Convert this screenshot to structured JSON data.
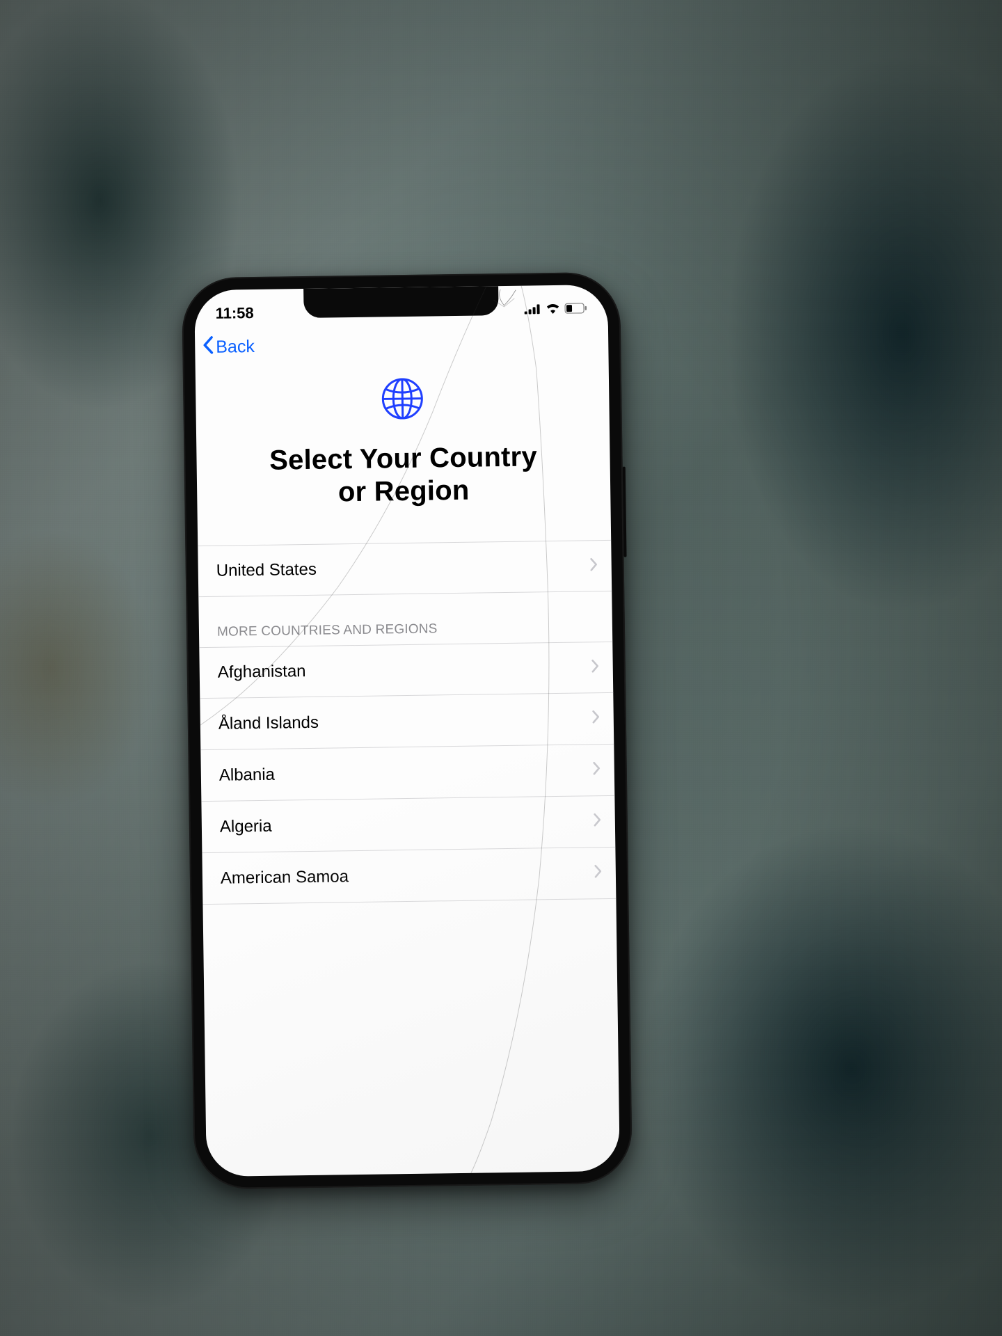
{
  "statusBar": {
    "time": "11:58"
  },
  "nav": {
    "backLabel": "Back"
  },
  "hero": {
    "titleLine1": "Select Your Country",
    "titleLine2": "or Region"
  },
  "primaryList": [
    {
      "label": "United States"
    }
  ],
  "sectionHeader": "MORE COUNTRIES AND REGIONS",
  "moreList": [
    {
      "label": "Afghanistan"
    },
    {
      "label": "Åland Islands"
    },
    {
      "label": "Albania"
    },
    {
      "label": "Algeria"
    },
    {
      "label": "American Samoa"
    }
  ],
  "colors": {
    "accent": "#0a60ff"
  }
}
